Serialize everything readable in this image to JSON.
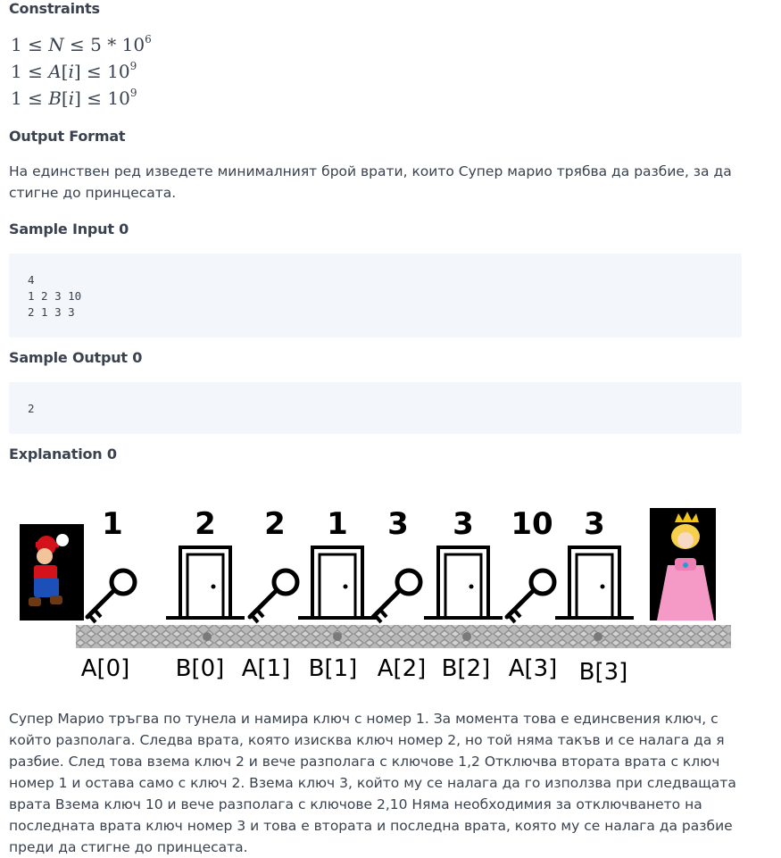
{
  "constraints": {
    "heading": "Constraints",
    "line1": {
      "lhs": "1 ≤ ",
      "var": "N",
      "rhs": " ≤ 5 * 10",
      "exp": "6"
    },
    "line2": {
      "lhs": "1 ≤ ",
      "var": "A",
      "idx": "[",
      "i": "i",
      "close": "]",
      "rhs": " ≤ 10",
      "exp": "9"
    },
    "line3": {
      "lhs": "1 ≤ ",
      "var": "B",
      "idx": "[",
      "i": "i",
      "close": "]",
      "rhs": " ≤ 10",
      "exp": "9"
    }
  },
  "output_format": {
    "heading": "Output Format",
    "text": "На единствен ред изведете минималният брой врати, които Супер марио трябва да разбие, за да стигне до принцесата."
  },
  "sample_input": {
    "heading": "Sample Input 0",
    "lines": [
      "4",
      "1 2 3 10",
      "2 1 3 3"
    ]
  },
  "sample_output": {
    "heading": "Sample Output 0",
    "lines": [
      "2"
    ]
  },
  "explanation": {
    "heading": "Explanation 0",
    "illustration": {
      "top_numbers": [
        "1",
        "2",
        "2",
        "1",
        "3",
        "3",
        "10",
        "3"
      ],
      "bottom_labels": [
        "A[0]",
        "B[0]",
        "A[1]",
        "B[1]",
        "A[2]",
        "B[2]",
        "A[3]",
        "B[3]"
      ],
      "items": [
        "key",
        "door",
        "key",
        "door",
        "key",
        "door",
        "key",
        "door"
      ]
    },
    "text": "Супер Марио тръгва по тунела и намира ключ с номер 1. За момента това е единсвения ключ, с който разполага. Следва врата, която изисква ключ номер 2, но той няма такъв и се налага да я разбие. След това взема ключ 2 и вече разполага с ключове 1,2 Отключва втората врата с ключ номер 1 и остава само с ключ 2. Взема ключ 3, който му се налага да го използва при следващата врата Взема ключ 10 и вече разполага с ключове 2,10 Няма необходимия за отключването на последната врата ключ номер 3 и това е втората и последна врата, която му се налага да разбие преди да стигне до принцесата."
  }
}
